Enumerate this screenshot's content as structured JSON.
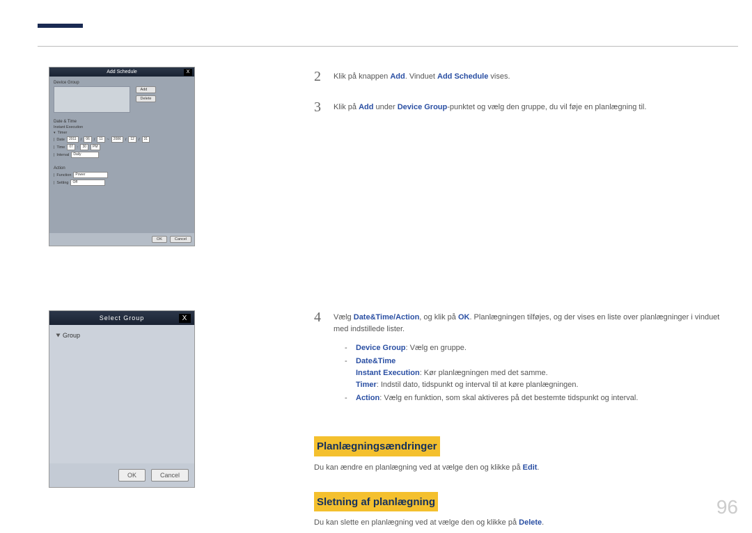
{
  "pageNumber": "96",
  "dialog1": {
    "title": "Add Schedule",
    "close": "X",
    "deviceGroupLabel": "Device Group",
    "addBtn": "Add",
    "deleteBtn": "Delete",
    "dateTimeLabel": "Date & Time",
    "instantExec": "Instant Execution",
    "timerLabel": "Timer",
    "dateRowLabel": "Date",
    "dateYear": "2011",
    "dateM1": "06",
    "dateD1": "11",
    "dateY2": "2086",
    "dateM2": "12",
    "dateD2": "31",
    "timeRowLabel": "Time",
    "timeH": "07",
    "timeM": "30",
    "ampm": "PM",
    "intervalLabel": "Interval",
    "intervalVal": "Daily",
    "actionLabel": "Action",
    "functionLabel": "Function",
    "functionVal": "Power",
    "settingLabel": "Setting",
    "settingVal": "Off",
    "okBtn": "OK",
    "cancelBtn": "Cancel"
  },
  "dialog2": {
    "title": "Select Group",
    "close": "X",
    "treeRoot": "Group",
    "okBtn": "OK",
    "cancelBtn": "Cancel"
  },
  "steps": {
    "s2": {
      "num": "2",
      "t1": "Klik på knappen ",
      "add": "Add",
      "t2": ". Vinduet ",
      "addSchedule": "Add Schedule",
      "t3": " vises."
    },
    "s3": {
      "num": "3",
      "t1": "Klik på ",
      "add": "Add",
      "t2": " under ",
      "deviceGroup": "Device Group",
      "t3": "-punktet og vælg den gruppe, du vil føje en planlægning til."
    },
    "s4": {
      "num": "4",
      "t1": "Vælg ",
      "datetimeaction": "Date&Time/Action",
      "t2": ", og klik på ",
      "ok": "OK",
      "t3": ". Planlægningen tilføjes, og der vises en liste over planlægninger i vinduet med indstillede lister.",
      "deviceGroup": "Device Group",
      "deviceGroupRest": ": Vælg en gruppe.",
      "dateTime": "Date&Time",
      "instantExec": "Instant Execution",
      "instantExecRest": ": Kør planlægningen med det samme.",
      "timer": "Timer",
      "timerRest": ": Indstil dato, tidspunkt og interval til at køre planlægningen.",
      "action": "Action",
      "actionRest": ": Vælg en funktion, som skal aktiveres på det bestemte tidspunkt og interval."
    }
  },
  "sections": {
    "changes": {
      "title": "Planlægningsændringer",
      "t1": "Du kan ændre en planlægning ved at vælge den og klikke på ",
      "edit": "Edit",
      "t2": "."
    },
    "delete": {
      "title": "Sletning af planlægning",
      "t1": "Du kan slette en planlægning ved at vælge den og klikke på ",
      "delete": "Delete",
      "t2": "."
    }
  }
}
